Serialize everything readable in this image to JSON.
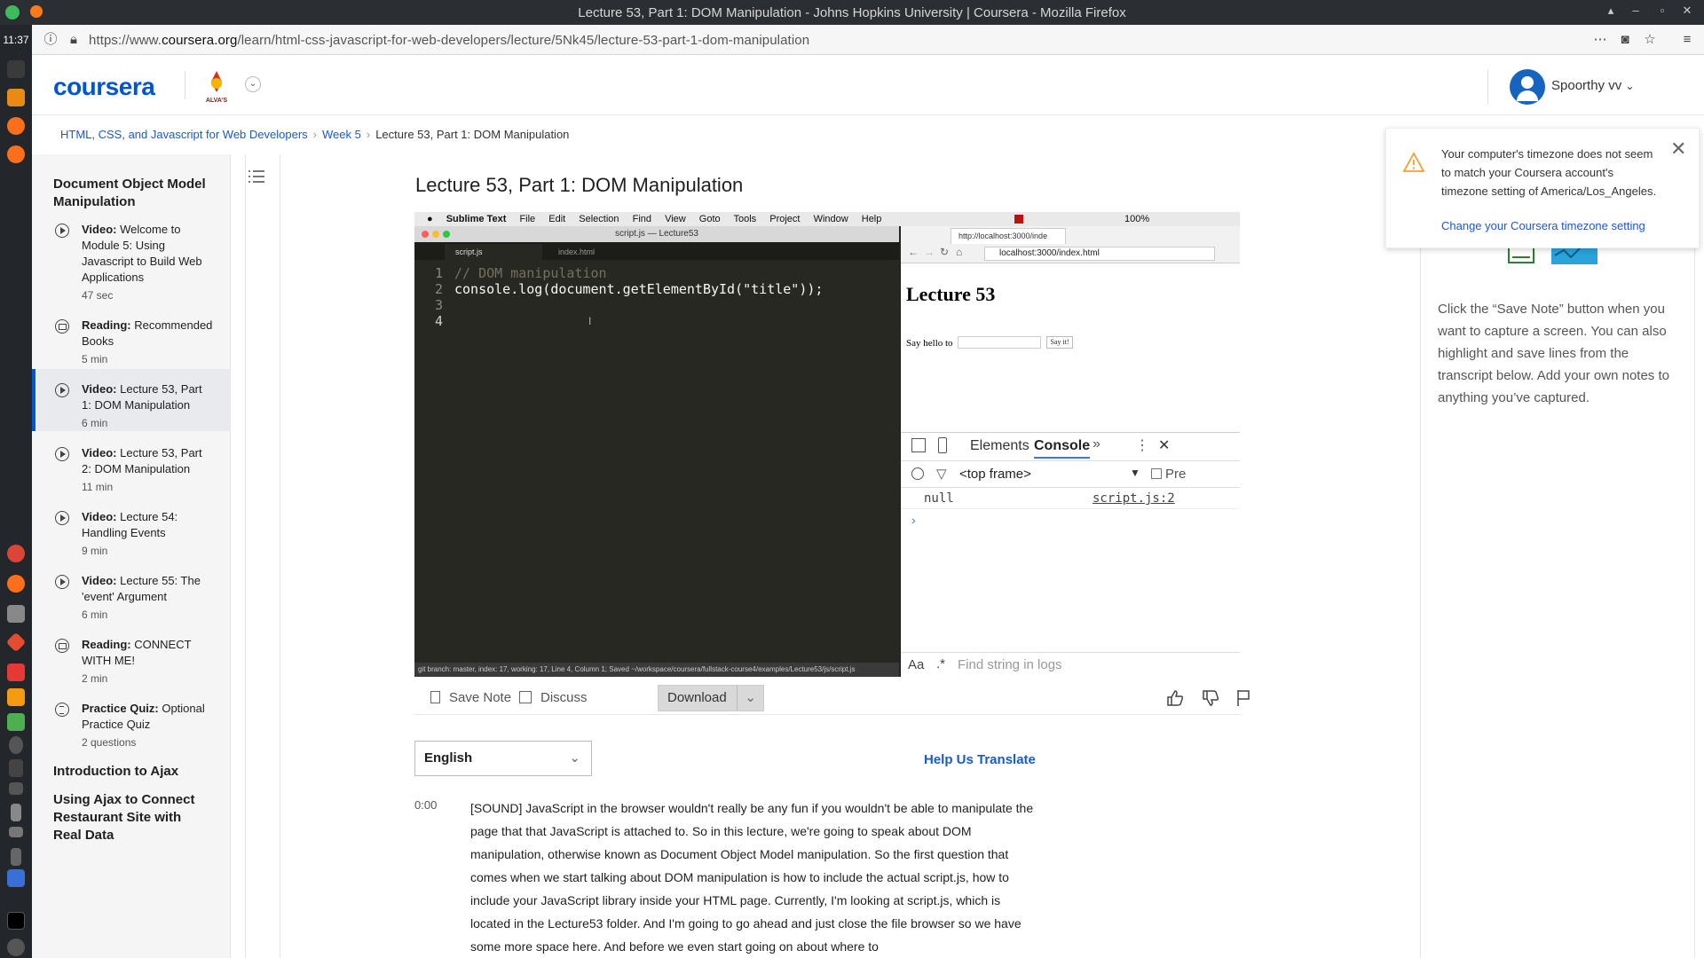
{
  "os": {
    "window_title": "Lecture 53, Part 1: DOM Manipulation - Johns Hopkins University | Coursera - Mozilla Firefox",
    "clock": "11:37"
  },
  "browser": {
    "url_prefix": "https://www.",
    "url_domain": "coursera.org",
    "url_path": "/learn/html-css-javascript-for-web-developers/lecture/5Nk45/lecture-53-part-1-dom-manipulation"
  },
  "header": {
    "logo": "coursera",
    "partner_label": "ALVA'S",
    "username": "Spoorthy vv"
  },
  "breadcrumb": {
    "course": "HTML, CSS, and Javascript for Web Developers",
    "week": "Week 5",
    "current": "Lecture 53, Part 1: DOM Manipulation"
  },
  "sidebar": {
    "module_title": "Document Object Model Manipulation",
    "items": [
      {
        "type_label": "Video:",
        "title": "Welcome to Module 5: Using Javascript to Build Web Applications",
        "duration": "47 sec",
        "icon": "play-icon"
      },
      {
        "type_label": "Reading:",
        "title": "Recommended Books",
        "duration": "5 min",
        "icon": "book-icon"
      },
      {
        "type_label": "Video:",
        "title": "Lecture 53, Part 1: DOM Manipulation",
        "duration": "6 min",
        "icon": "play-icon"
      },
      {
        "type_label": "Video:",
        "title": "Lecture 53, Part 2: DOM Manipulation",
        "duration": "11 min",
        "icon": "play-icon"
      },
      {
        "type_label": "Video:",
        "title": "Lecture 54: Handling Events",
        "duration": "9 min",
        "icon": "play-icon"
      },
      {
        "type_label": "Video:",
        "title": "Lecture 55: The 'event' Argument",
        "duration": "6 min",
        "icon": "play-icon"
      },
      {
        "type_label": "Reading:",
        "title": "CONNECT WITH ME!",
        "duration": "2 min",
        "icon": "book-icon"
      },
      {
        "type_label": "Practice Quiz:",
        "title": "Optional Practice Quiz",
        "duration": "2 questions",
        "icon": "quiz-icon"
      }
    ],
    "section_2": "Introduction to Ajax",
    "section_3": "Using Ajax to Connect Restaurant Site with Real Data"
  },
  "lecture": {
    "title": "Lecture 53, Part 1: DOM Manipulation"
  },
  "video": {
    "mac_menu": [
      "Sublime Text",
      "File",
      "Edit",
      "Selection",
      "Find",
      "View",
      "Goto",
      "Tools",
      "Project",
      "Window",
      "Help"
    ],
    "mac_battery": "100%",
    "editor_window_title": "script.js — Lecture53",
    "editor_tabs": [
      "script.js",
      "index.html"
    ],
    "code_lines": [
      {
        "n": "1",
        "text": "// DOM manipulation"
      },
      {
        "n": "2",
        "text": "console.log(document.getElementById(\"title\"));"
      },
      {
        "n": "3",
        "text": ""
      },
      {
        "n": "4",
        "text": ""
      }
    ],
    "editor_status": "git branch: master, index: 17, working: 17, Line 4, Column 1; Saved ~/workspace/coursera/fullstack-course4/examples/Lecture53/js/script.js",
    "browser_tab": "http://localhost:3000/inde",
    "browser_address": "localhost:3000/index.html",
    "page_heading": "Lecture 53",
    "say_hello_label": "Say hello to",
    "say_it_button": "Say it!",
    "devtools_tabs": [
      "Elements",
      "Console"
    ],
    "devtools_frame": "<top frame>",
    "devtools_preserve": "Pre",
    "log_value": "null",
    "log_source": "script.js:2",
    "find_placeholder": "Find string in logs",
    "find_case": "Aa"
  },
  "toolbar": {
    "save_note": "Save Note",
    "discuss": "Discuss",
    "download": "Download"
  },
  "transcript": {
    "language": "English",
    "help_translate": "Help Us Translate",
    "timestamp": "0:00",
    "text": "[SOUND] JavaScript in the browser wouldn't really be any fun if you wouldn't be able to manipulate the page that that JavaScript is attached to. So in this lecture, we're going to speak about DOM manipulation, otherwise known as Document Object Model manipulation. So the first question that comes when we start talking about DOM manipulation is how to include the actual script.js, how to include your JavaScript library inside your HTML page. Currently, I'm looking at script.js, which is located in the Lecture53 folder. And I'm going to go ahead and just close the file browser so we have some more space here. And before we even start going on about where to"
  },
  "notes": {
    "instructions": "Click the “Save Note” button when you want to capture a screen. You can also highlight and save lines from the transcript below. Add your own notes to anything you’ve captured."
  },
  "timezone_toast": {
    "message": "Your computer's timezone does not seem to match your Coursera account's timezone setting of America/Los_Angeles.",
    "link": "Change your Coursera timezone setting"
  },
  "colors": {
    "brand": "#0056d2",
    "link": "#1a5ac9",
    "editor_bg": "#272822",
    "warning": "#f0a030"
  }
}
